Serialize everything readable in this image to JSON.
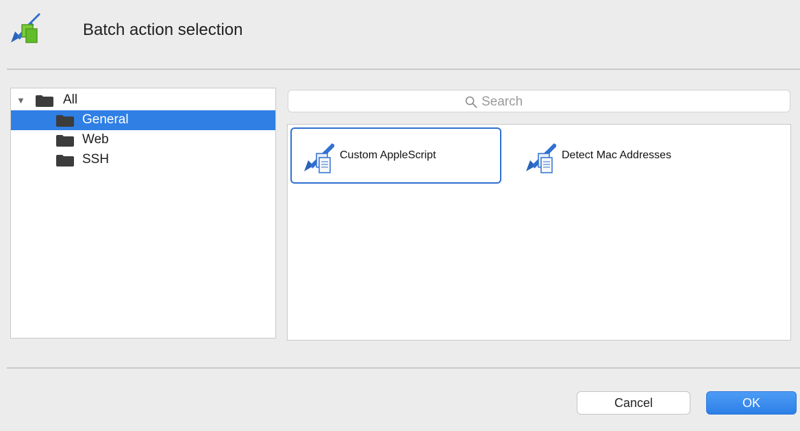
{
  "dialog": {
    "title": "Batch action selection",
    "app_icon": "batch-pencil-icon"
  },
  "tree": {
    "items": [
      {
        "label": "All",
        "expanded": true,
        "icon": "folder-icon",
        "selected": false
      },
      {
        "label": "General",
        "icon": "folder-icon",
        "selected": true
      },
      {
        "label": "Web",
        "icon": "folder-icon",
        "selected": false
      },
      {
        "label": "SSH",
        "icon": "folder-icon",
        "selected": false
      }
    ]
  },
  "search": {
    "placeholder": "Search",
    "icon": "search-icon"
  },
  "actions": {
    "items": [
      {
        "label": "Custom AppleScript",
        "icon": "script-pencil-icon",
        "selected": true
      },
      {
        "label": "Detect Mac Addresses",
        "icon": "script-pencil-icon",
        "selected": false
      }
    ]
  },
  "footer": {
    "cancel_label": "Cancel",
    "ok_label": "OK"
  },
  "colors": {
    "selection": "#2f7fe4",
    "accent_border": "#2f6fd1",
    "ok_button": "#3a8ff0"
  }
}
